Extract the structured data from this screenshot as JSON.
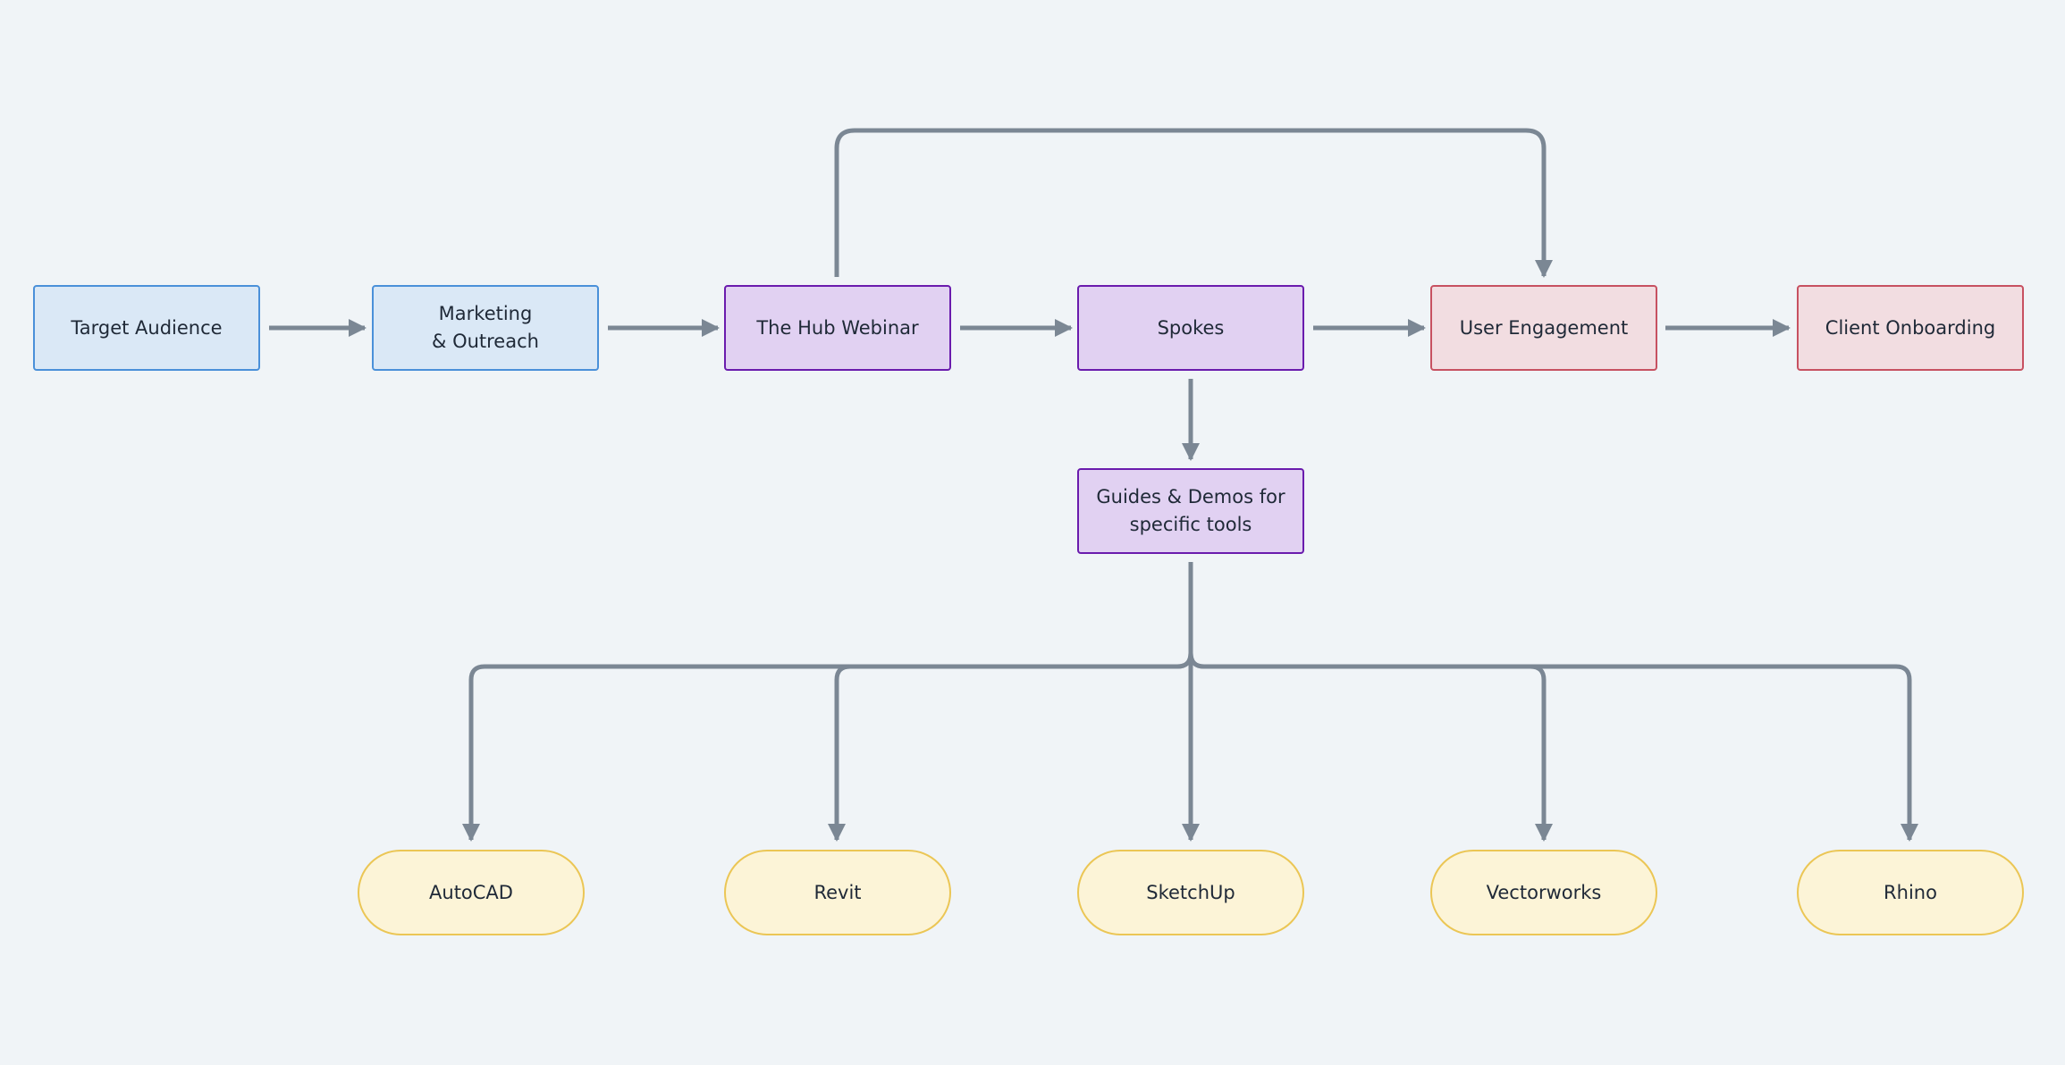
{
  "nodes": {
    "target_audience": "Target Audience",
    "marketing_line1": "Marketing",
    "marketing_line2": "& Outreach",
    "hub_webinar": "The Hub Webinar",
    "spokes": "Spokes",
    "user_engagement": "User Engagement",
    "client_onboarding": "Client Onboarding",
    "guides_line1": "Guides & Demos for",
    "guides_line2": "specific tools",
    "autocad": "AutoCAD",
    "revit": "Revit",
    "sketchup": "SketchUp",
    "vectorworks": "Vectorworks",
    "rhino": "Rhino"
  },
  "edges": [
    {
      "from": "target_audience",
      "to": "marketing"
    },
    {
      "from": "marketing",
      "to": "hub_webinar"
    },
    {
      "from": "hub_webinar",
      "to": "spokes"
    },
    {
      "from": "spokes",
      "to": "user_engagement"
    },
    {
      "from": "user_engagement",
      "to": "client_onboarding"
    },
    {
      "from": "hub_webinar",
      "to": "user_engagement"
    },
    {
      "from": "spokes",
      "to": "guides"
    },
    {
      "from": "guides",
      "to": "autocad"
    },
    {
      "from": "guides",
      "to": "revit"
    },
    {
      "from": "guides",
      "to": "sketchup"
    },
    {
      "from": "guides",
      "to": "vectorworks"
    },
    {
      "from": "guides",
      "to": "rhino"
    }
  ],
  "colors": {
    "background": "#f0f4f7",
    "edge": "#7b8794",
    "blue_fill": "#dae8f6",
    "blue_border": "#4a90d9",
    "purple_fill": "#e1d1f2",
    "purple_border": "#6a1bad",
    "red_fill": "#f2dde1",
    "red_border": "#c75161",
    "yellow_fill": "#fcf4d7",
    "yellow_border": "#ebc655"
  }
}
